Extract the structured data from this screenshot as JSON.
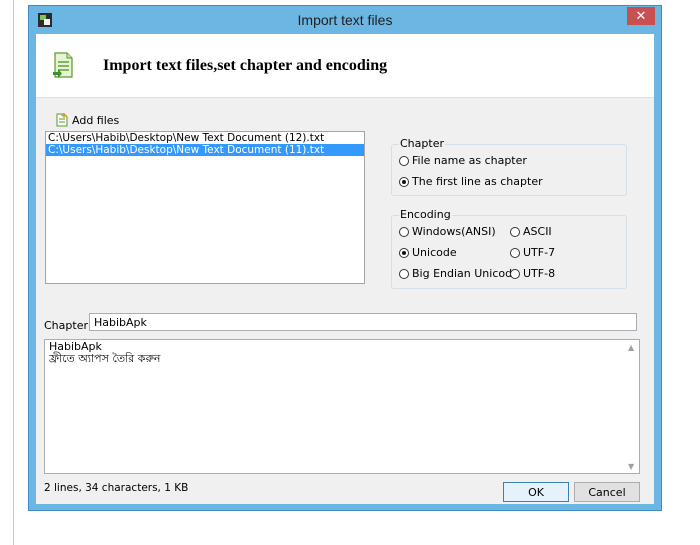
{
  "window": {
    "title": "Import text files",
    "close_glyph": "✕"
  },
  "header": {
    "title": "Import text files,set chapter and encoding",
    "icon": "document-import-icon"
  },
  "toolbar": {
    "add_files_label": "Add files"
  },
  "files": [
    {
      "path": "C:\\Users\\Habib\\Desktop\\New Text Document (12).txt",
      "selected": false
    },
    {
      "path": "C:\\Users\\Habib\\Desktop\\New Text Document (11).txt",
      "selected": true
    }
  ],
  "chapter_group": {
    "legend": "Chapter",
    "options": [
      {
        "label": "File name as chapter",
        "checked": false
      },
      {
        "label": "The first line as chapter",
        "checked": true
      }
    ]
  },
  "encoding_group": {
    "legend": "Encoding",
    "options": [
      {
        "label": "Windows(ANSI)",
        "checked": false
      },
      {
        "label": "ASCII",
        "checked": false
      },
      {
        "label": "Unicode",
        "checked": true
      },
      {
        "label": "UTF-7",
        "checked": false
      },
      {
        "label": "Big Endian Unicode",
        "checked": false
      },
      {
        "label": "UTF-8",
        "checked": false
      }
    ]
  },
  "chapter_field": {
    "label": "Chapter:",
    "value": "HabibApk"
  },
  "preview": {
    "lines": [
      "HabibApk",
      "ফ্রীতে অ্যাপস তৈরি করুন"
    ]
  },
  "status": "2 lines, 34 characters, 1 KB",
  "buttons": {
    "ok": "OK",
    "cancel": "Cancel"
  },
  "colors": {
    "frame": "#6cb6e4",
    "selection": "#3399ff",
    "close": "#c75050"
  }
}
